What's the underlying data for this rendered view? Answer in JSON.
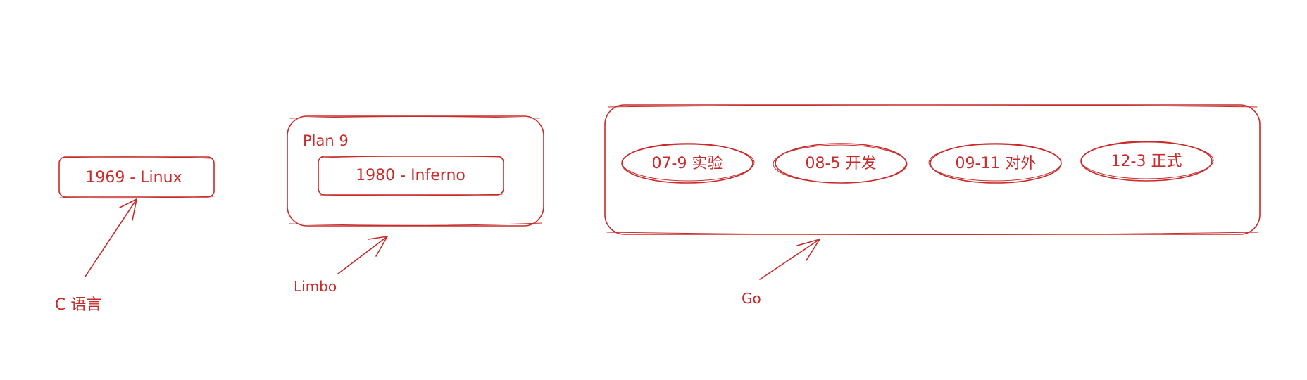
{
  "colors": {
    "stroke": "#c92a2a",
    "background": "#ffffff"
  },
  "nodes": {
    "linux": "1969 - Linux",
    "plan9_title": "Plan 9",
    "inferno": "1980 - Inferno"
  },
  "go_items": [
    "07-9 实验",
    "08-5 开发",
    "09-11 对外",
    "12-3 正式"
  ],
  "labels": {
    "c_lang": "C 语言",
    "limbo": "Limbo",
    "go": "Go"
  },
  "edges": [
    {
      "from": "c_lang",
      "to": "linux"
    },
    {
      "from": "limbo",
      "to": "plan9_title"
    },
    {
      "from": "go",
      "to": "go_items"
    }
  ]
}
